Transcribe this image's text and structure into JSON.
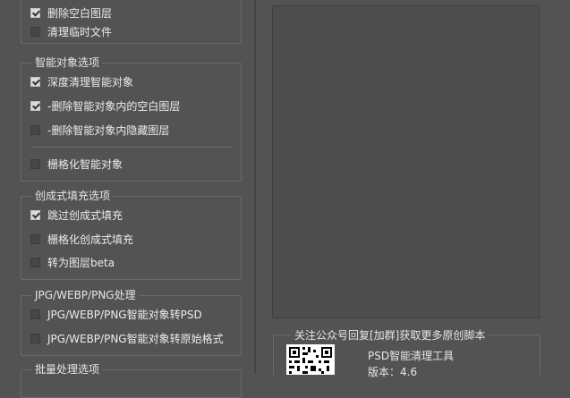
{
  "top_options": [
    {
      "label": "删除空白图层",
      "checked": true
    },
    {
      "label": "清理临时文件",
      "checked": false
    }
  ],
  "smart_object": {
    "title": "智能对象选项",
    "items": [
      {
        "label": "深度清理智能对象",
        "checked": true
      },
      {
        "label": "-删除智能对象内的空白图层",
        "checked": true
      },
      {
        "label": "-删除智能对象内隐藏图层",
        "checked": false
      },
      {
        "label": "栅格化智能对象",
        "checked": false
      }
    ]
  },
  "generative_fill": {
    "title": "创成式填充选项",
    "items": [
      {
        "label": "跳过创成式填充",
        "checked": true
      },
      {
        "label": "栅格化创成式填充",
        "checked": false
      },
      {
        "label": "转为图层beta",
        "checked": false
      }
    ]
  },
  "jpg_webp_png": {
    "title": "JPG/WEBP/PNG处理",
    "items": [
      {
        "label": "JPG/WEBP/PNG智能对象转PSD",
        "checked": false
      },
      {
        "label": "JPG/WEBP/PNG智能对象转原始格式",
        "checked": false
      }
    ]
  },
  "batch": {
    "title": "批量处理选项"
  },
  "promo": {
    "title": "关注公众号回复[加群]获取更多原创脚本",
    "tool_name": "PSD智能清理工具",
    "version": "版本：4.6"
  },
  "colors": {
    "background": "#535353",
    "border": "#6a6a6a",
    "preview": "#4d4d4d"
  }
}
